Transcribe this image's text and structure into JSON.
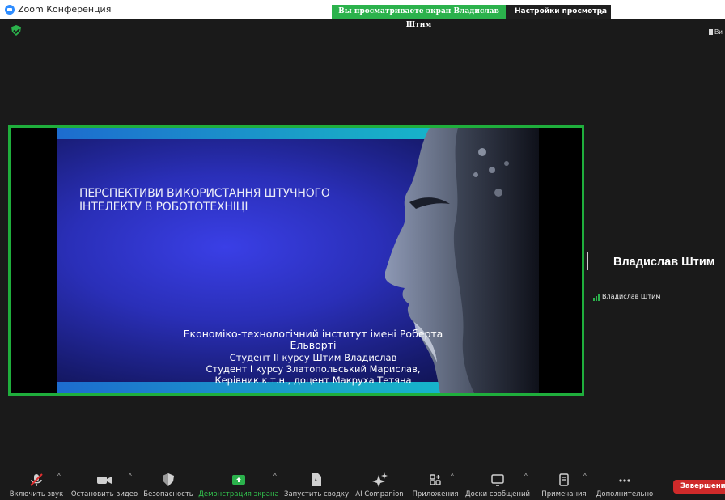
{
  "window": {
    "title": "Zoom Конференция"
  },
  "share_bar": {
    "banner": "Вы просматриваете экран Владислав Штим",
    "view_options": "Настройки просмотра"
  },
  "view_toggle": {
    "label": "Ви"
  },
  "slide": {
    "title_line1": "ПЕРСПЕКТИВИ ВИКОРИСТАННЯ ШТУЧНОГО",
    "title_line2": "ІНТЕЛЕКТУ В РОБОТОТЕХНІЦІ",
    "line1": "Економіко-технологічний інститут імені Роберта Ельворті",
    "line2": "Студент  ІІ курсу Штим Владислав",
    "line3": "Студент І курсу Златопольський Марислав,",
    "line4": "Керівник  к.т.н., доцент Макруха Тетяна"
  },
  "participant": {
    "name": "Владислав Штим",
    "tile_label": "Владислав Штим"
  },
  "toolbar": {
    "unmute": "Включить звук",
    "stop_video": "Остановить видео",
    "security": "Безопасность",
    "share_screen": "Демонстрация экрана",
    "summary": "Запустить сводку",
    "ai_companion": "AI Companion",
    "apps": "Приложения",
    "whiteboards": "Доски сообщений",
    "notes": "Примечания",
    "more": "Дополнительно",
    "end": "Завершение"
  },
  "colors": {
    "accent_green": "#2bb24c",
    "end_red": "#cf2a2a",
    "zoom_blue": "#2d8cff"
  }
}
